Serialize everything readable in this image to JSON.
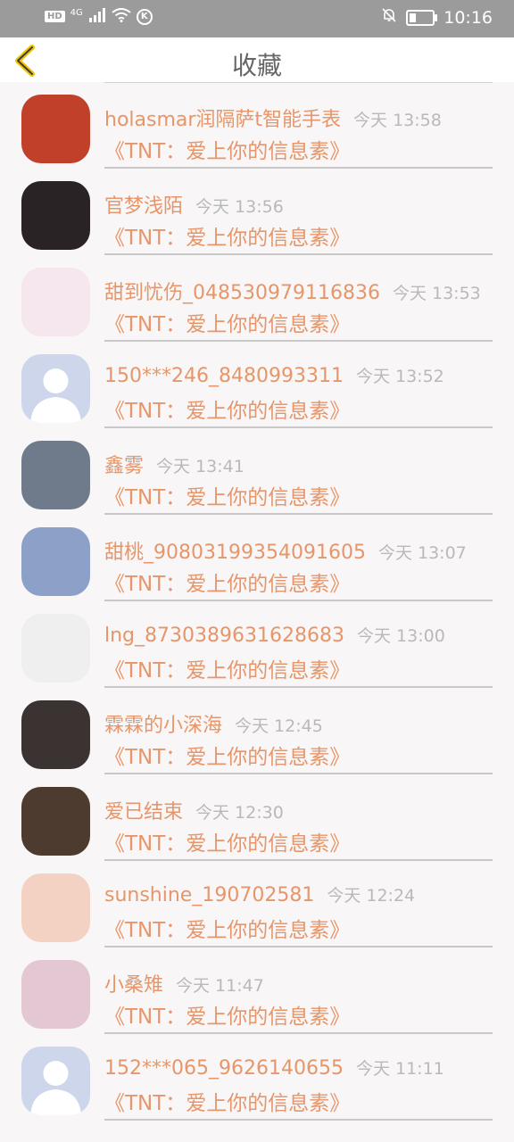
{
  "status_bar": {
    "hd": "HD",
    "network": "4G",
    "k_badge": "K",
    "time": "10:16",
    "battery_level": 0.3
  },
  "header": {
    "title": "收藏",
    "back_icon": "chevron-left-icon",
    "back_color": "#f0c400"
  },
  "items": [
    {
      "name": "holasmar润隔萨t智能手表",
      "time": "今天 13:58",
      "book": "《TNT：爱上你的信息素》",
      "avatar_color": "#c0402a"
    },
    {
      "name": "官梦浅陌",
      "time": "今天 13:56",
      "book": "《TNT：爱上你的信息素》",
      "avatar_color": "#2a2325"
    },
    {
      "name": "甜到忧伤_048530979116836",
      "time": "今天 13:53",
      "book": "《TNT：爱上你的信息素》",
      "avatar_color": "#f6e7ee"
    },
    {
      "name": "150***246_8480993311",
      "time": "今天 13:52",
      "book": "《TNT：爱上你的信息素》",
      "avatar_color": "#cdd6ea"
    },
    {
      "name": "鑫雾",
      "time": "今天 13:41",
      "book": "《TNT：爱上你的信息素》",
      "avatar_color": "#6f7b8a"
    },
    {
      "name": "甜桃_90803199354091605",
      "time": "今天 13:07",
      "book": "《TNT：爱上你的信息素》",
      "avatar_color": "#8da0c8"
    },
    {
      "name": "lng_8730389631628683",
      "time": "今天 13:00",
      "book": "《TNT：爱上你的信息素》",
      "avatar_color": "#efefef"
    },
    {
      "name": "霖霖的小深海",
      "time": "今天 12:45",
      "book": "《TNT：爱上你的信息素》",
      "avatar_color": "#3a3332"
    },
    {
      "name": "爱已结束",
      "time": "今天 12:30",
      "book": "《TNT：爱上你的信息素》",
      "avatar_color": "#4d3b30"
    },
    {
      "name": "sunshine_190702581",
      "time": "今天 12:24",
      "book": "《TNT：爱上你的信息素》",
      "avatar_color": "#f4d2c3"
    },
    {
      "name": "小桑雉",
      "time": "今天 11:47",
      "book": "《TNT：爱上你的信息素》",
      "avatar_color": "#e3c7d2"
    },
    {
      "name": "152***065_9626140655",
      "time": "今天 11:11",
      "book": "《TNT：爱上你的信息素》",
      "avatar_color": "#cdd6ea"
    }
  ]
}
